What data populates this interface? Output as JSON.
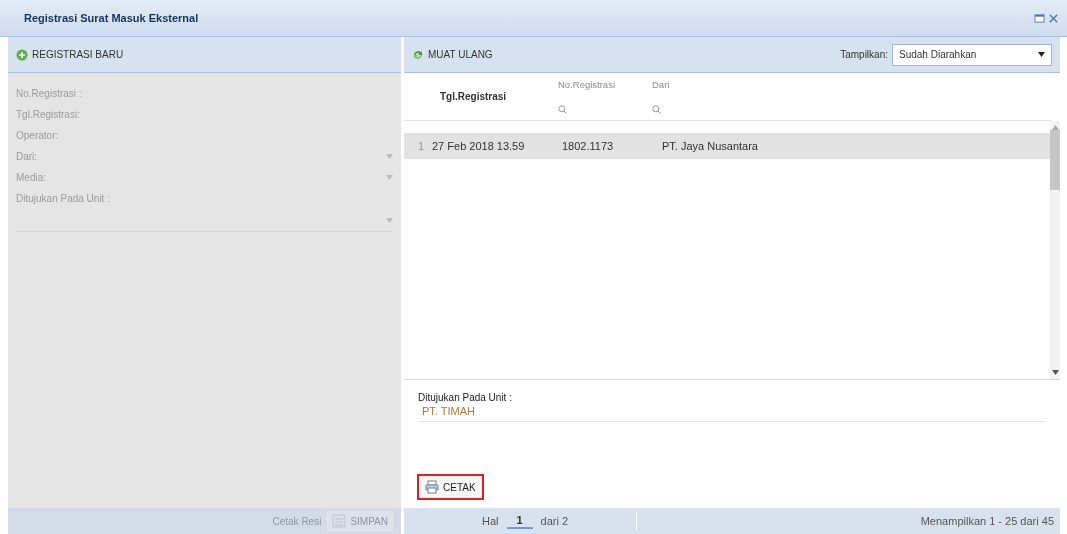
{
  "window": {
    "title": "Registrasi Surat Masuk Eksternal"
  },
  "left_panel": {
    "header": "REGISTRASI BARU",
    "disabled": true,
    "fields": [
      {
        "kind": "text",
        "label": "No.Registrasi :"
      },
      {
        "kind": "text",
        "label": "Tgl.Registrasi:"
      },
      {
        "kind": "text",
        "label": "Operator:"
      },
      {
        "kind": "combo",
        "label": "Dari:"
      },
      {
        "kind": "combo",
        "label": "Media:"
      },
      {
        "kind": "combo_below",
        "label": "Ditujukan Pada Unit :"
      }
    ],
    "footer": {
      "link": "Cetak Resi",
      "button": "SIMPAN"
    }
  },
  "right_panel": {
    "reload": "MUAT ULANG",
    "filter_label": "Tampilkan:",
    "filter_value": "Sudah Diarahkan",
    "table": {
      "columns": [
        {
          "label": "Tgl.Registrasi",
          "filter": false
        },
        {
          "label": "No.Registrasi",
          "filter": true
        },
        {
          "label": "Dari",
          "filter": true
        }
      ],
      "rows": [
        {
          "number": "1",
          "cells": [
            "27 Feb 2018 13.59",
            "1802.1173",
            "PT. Jaya Nusantara"
          ],
          "selected": true
        }
      ]
    },
    "detail": {
      "label": "Ditujukan Pada Unit :",
      "value": "PT. TIMAH"
    },
    "print_button": "CETAK",
    "print_highlighted": true,
    "pager": {
      "prefix": "Hal",
      "page": "1",
      "suffix": "dari 2",
      "summary": "Menampilkan 1 - 25 dari 45"
    }
  }
}
